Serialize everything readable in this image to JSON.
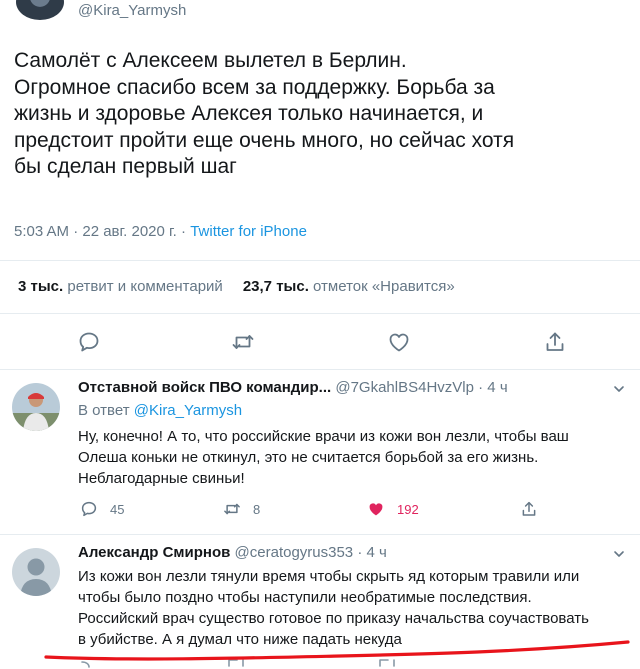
{
  "tweet": {
    "handle": "@Kira_Yarmysh",
    "lines": [
      "Самолёт с Алексеем вылетел в Берлин.",
      "Огромное спасибо всем за поддержку. Борьба за",
      "жизнь и здоровье Алексея только начинается, и",
      "предстоит пройти еще очень много, но сейчас хотя",
      "бы сделан первый шаг"
    ],
    "time": "5:03 AM · 22 авг. 2020 г. ·",
    "source": "Twitter for iPhone",
    "retweets_count": "3 тыс.",
    "retweets_label": "ретвит и комментарий",
    "likes_count": "23,7 тыс.",
    "likes_label": "отметок «Нравится»"
  },
  "icons": {
    "reply": "reply-icon",
    "retweet": "retweet-icon",
    "like": "heart-icon",
    "share": "share-icon",
    "more": "chevron-down-icon"
  },
  "replies": [
    {
      "name": "Отставной войск ПВО командир...",
      "handle": "@7GkahlBS4HvzVlp",
      "time": "· 4 ч",
      "reply_prefix": "В ответ",
      "reply_to": "@Kira_Yarmysh",
      "lines": [
        "Ну, конечно! А то, что российские врачи из кожи вон лезли, чтобы ваш",
        "Олеша коньки не откинул, это не считается борьбой за его жизнь.",
        "Неблагодарные свиньи!"
      ],
      "replies_count": "45",
      "retweets_count": "8",
      "likes_count": "192"
    },
    {
      "name": "Александр Смирнов",
      "handle": "@ceratogyrus353",
      "time": "· 4 ч",
      "lines": [
        "Из кожи вон лезли тянули время чтобы скрыть яд которым травили или",
        "чтобы было поздно чтобы наступили необратимые последствия.",
        "Российский врач существо готовое по приказу начальства соучаствовать",
        "в убийстве. А я думал что ниже падать некуда"
      ]
    }
  ],
  "colors": {
    "text": "#14171a",
    "muted": "#657786",
    "link": "#1b95e0",
    "like": "#e0245e",
    "annotation": "#e8141b"
  }
}
